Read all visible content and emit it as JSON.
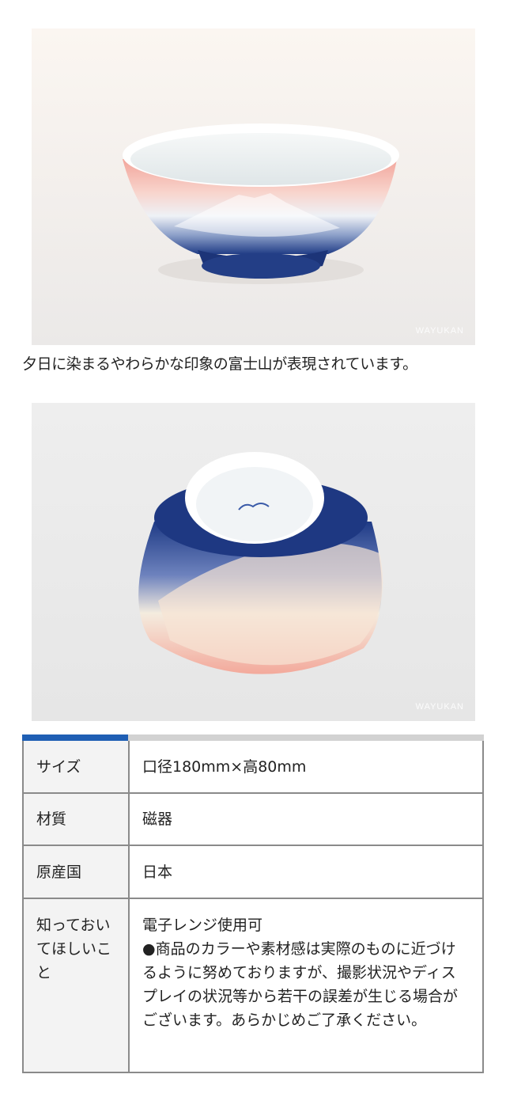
{
  "images": [
    {
      "alt": "bowl-side-view",
      "watermark": "WAYUKAN"
    },
    {
      "alt": "bowl-bottom-view",
      "watermark": "WAYUKAN"
    }
  ],
  "caption": "夕日に染まるやわらかな印象の富士山が表現されています。",
  "spec": {
    "colors": {
      "accent": "#1f5fb4",
      "bar": "#d2d2d2",
      "border": "#8a8a8a",
      "label_bg": "#f3f3f3"
    },
    "rows": [
      {
        "label": "サイズ",
        "value": "口径180mm×高80mm"
      },
      {
        "label": "材質",
        "value": "磁器"
      },
      {
        "label": "原産国",
        "value": "日本"
      },
      {
        "label": "知っておいてほしいこと",
        "value_lines": [
          "電子レンジ使用可",
          "●商品のカラーや素材感は実際のものに近づけるように努めておりますが、撮影状況やディスプレイの状況等から若干の誤差が生じる場合がございます。あらかじめご了承ください。"
        ]
      }
    ]
  }
}
